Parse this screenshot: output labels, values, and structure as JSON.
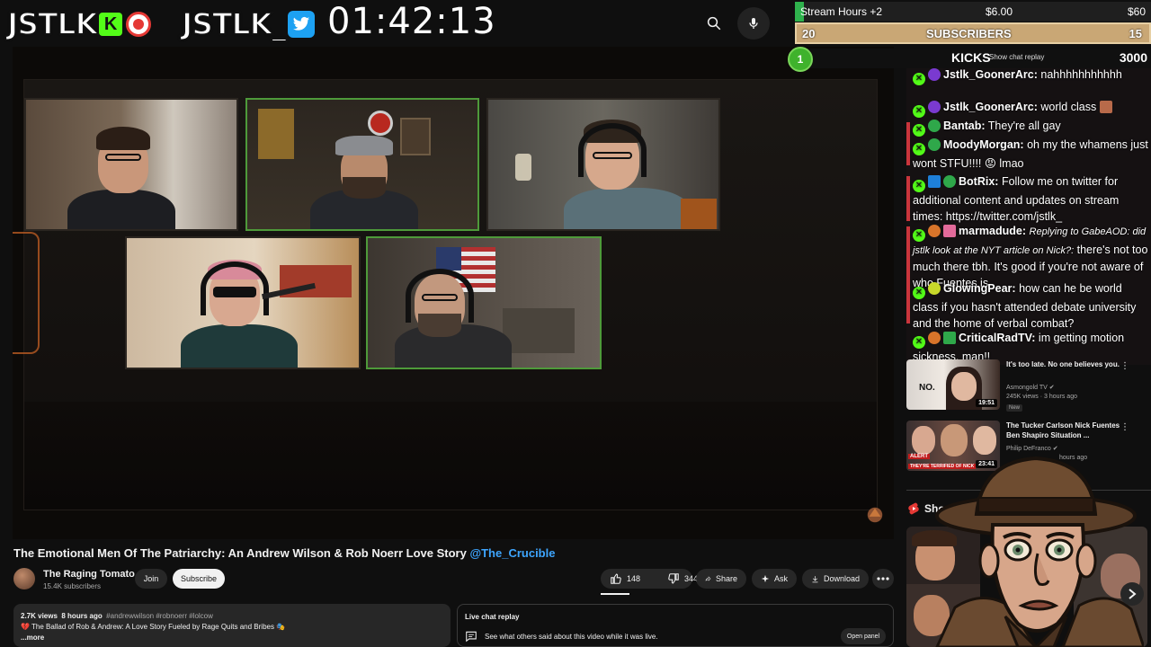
{
  "overlay": {
    "logo_text": "JSTLK",
    "logo2_text": "JSTLK_",
    "kick_badge": "K",
    "timer": "01:42:13"
  },
  "goals": {
    "stream_hours_label": "Stream Hours +2",
    "stream_hours_mid": "$6.00",
    "stream_hours_end": "$60",
    "subs_current": "20",
    "subs_label": "SUBSCRIBERS",
    "subs_target": "15",
    "kicks_circle": "1",
    "kicks_label": "KICKS",
    "kicks_value": "3000",
    "show_chat_replay": "Show chat replay"
  },
  "chat": {
    "messages": [
      {
        "user": "Jstlk_GoonerArc:",
        "text": "nahhhhhhhhhhh"
      },
      {
        "user": "Jstlk_GoonerArc:",
        "text": "world class"
      },
      {
        "user": "Bantab:",
        "text": "They're all gay"
      },
      {
        "user": "MoodyMorgan:",
        "text": "oh my the whamens just wont STFU!!!! 😡 lmao"
      },
      {
        "user": "BotRix:",
        "text": "Follow me on twitter for additional content and updates on stream times: https://twitter.com/jstlk_"
      },
      {
        "user": "marmadude:",
        "reply": "Replying to GabeAOD: did jstlk look at the NYT article on Nick?:",
        "text": "there's not too much there tbh. It's good if you're not aware of who Fuentes is"
      },
      {
        "user": "GlowingPear:",
        "text": "how can he be world class if you hasn't attended debate university and the home of verbal combat?"
      },
      {
        "user": "CriticalRadTV:",
        "text": "im getting motion sickness, man!!"
      }
    ]
  },
  "video": {
    "title": "The Emotional Men Of The Patriarchy: An Andrew Wilson & Rob Noerr Love Story",
    "title_tag": "@The_Crucible",
    "channel_name": "The Raging Tomato",
    "channel_subs": "15.4K subscribers",
    "join_label": "Join",
    "subscribe_label": "Subscribe",
    "likes": "148",
    "dislikes": "344",
    "share_label": "Share",
    "ask_label": "Ask",
    "download_label": "Download"
  },
  "description": {
    "views": "2.7K views",
    "age": "8 hours ago",
    "tags": "#andrewwilson #robnoerr #lolcow",
    "line": "💔 The Ballad of Rob & Andrew: A Love Story Fueled by Rage Quits and Bribes 🎭",
    "more": "...more"
  },
  "live_replay": {
    "title": "Live chat replay",
    "subtitle": "See what others said about this video while it was live.",
    "button": "Open panel"
  },
  "recommendations": [
    {
      "title": "It's too late. No one believes you.",
      "channel": "Asmongold TV",
      "views": "245K views · 3 hours ago",
      "badge": "New",
      "duration": "19:51",
      "thumb_text": "NO."
    },
    {
      "title": "The Tucker Carlson Nick Fuentes Ben Shapiro Situation ...",
      "channel": "Philip DeFranco",
      "views": "hours ago",
      "duration": "23:41",
      "thumb_text": "ALERT",
      "thumb_text2": "THEY'RE TERRIFIED OF NICK"
    }
  ],
  "shorts": {
    "label": "Sho"
  },
  "colors": {
    "kick_green": "#53fc18",
    "subscribe_bg": "#f1f1f1",
    "link_blue": "#3ea6ff",
    "goal_gold": "#c9a775",
    "active_cam": "#4e9a3a"
  }
}
